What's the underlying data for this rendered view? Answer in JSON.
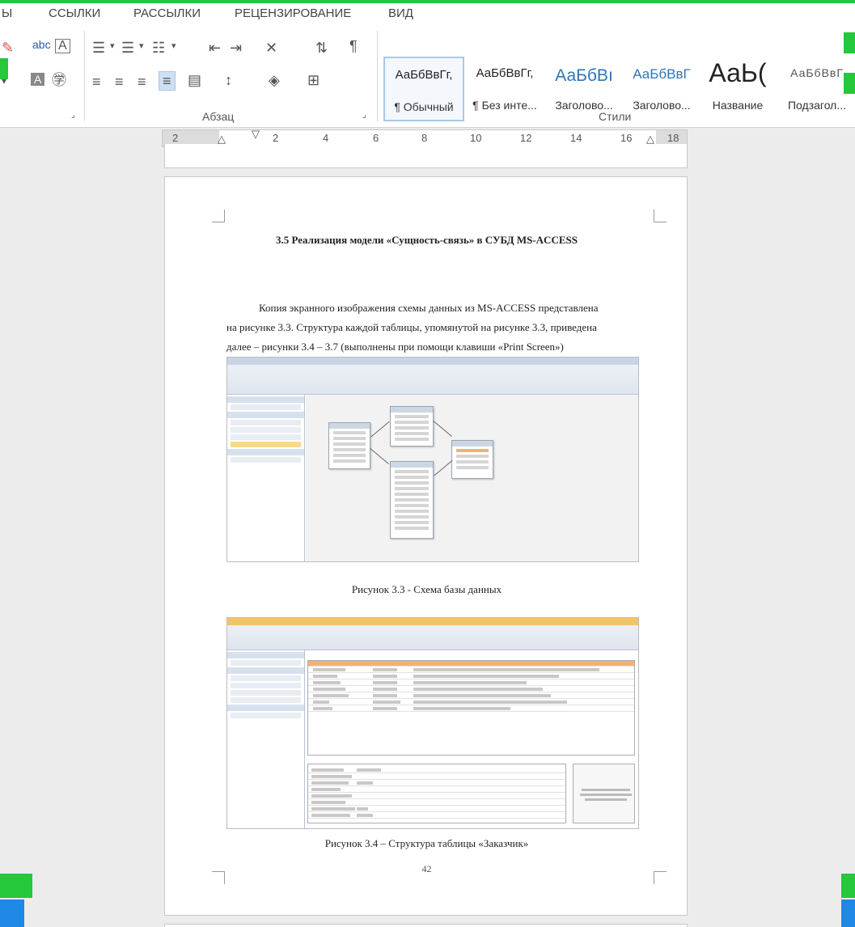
{
  "ribbon": {
    "tabs": [
      "Ы",
      "ССЫЛКИ",
      "РАССЫЛКИ",
      "РЕЦЕНЗИРОВАНИЕ",
      "ВИД"
    ],
    "groups": {
      "paragraph": "Абзац",
      "styles": "Стили"
    },
    "styles": [
      {
        "sample": "АаБбВвГг,",
        "name": "¶ Обычный"
      },
      {
        "sample": "АаБбВвГг,",
        "name": "¶ Без инте..."
      },
      {
        "sample": "АаБбВı",
        "name": "Заголово..."
      },
      {
        "sample": "АаБбВвГ",
        "name": "Заголово..."
      },
      {
        "sample": "АаЬ(",
        "name": "Название"
      },
      {
        "sample": "АаБбВвГ",
        "name": "Подзагол..."
      }
    ],
    "font_icons": {
      "abc": "abc",
      "A": "A"
    },
    "colors": {
      "accent_green": "#24c83a",
      "selection": "#cfe0f4",
      "heading_blue": "#2e75b6"
    }
  },
  "ruler": {
    "labels": [
      "2",
      "2",
      "4",
      "6",
      "8",
      "10",
      "12",
      "14",
      "16",
      "18"
    ]
  },
  "document": {
    "heading": "3.5 Реализация модели «Сущность-связь» в СУБД MS-ACCESS",
    "paragraph": [
      "Копия экранного изображения схемы данных из MS-ACCESS представлена",
      "на рисунке 3.3. Структура каждой таблицы, упомянутой на рисунке 3.3, приведена",
      "далее – рисунки 3.4 – 3.7 (выполнены при помощи клавиши «Print Screen»)"
    ],
    "figure1_caption": "Рисунок 3.3 - Схема базы данных",
    "figure2_caption": "Рисунок 3.4 – Структура таблицы «Заказчик»",
    "page_number": "42"
  }
}
